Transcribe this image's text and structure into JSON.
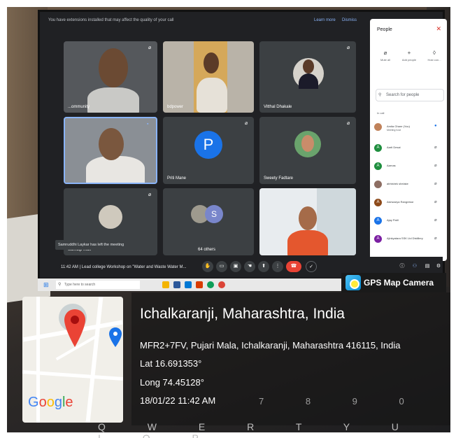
{
  "banner": {
    "text": "You have extensions installed that may affect the quality of your call",
    "learn_more": "Learn more",
    "dismiss": "Dismiss"
  },
  "tiles": [
    {
      "name": "...ommunity"
    },
    {
      "name": "bdpower"
    },
    {
      "name": "Vitthal Dhakale"
    },
    {
      "name": "",
      "initial": ""
    },
    {
      "name": "Priti Mane",
      "initial": "P"
    },
    {
      "name": "Sweety Fadtare"
    },
    {
      "name": "Samdip Mali"
    },
    {
      "name": "64 others",
      "initial": "S"
    },
    {
      "name": ""
    }
  ],
  "toast": "Samruddhi Laykar has left the meeting",
  "callbar": {
    "time_title": "11:42 AM  |  Lead college Workshop on \"Water and Waste Water M..."
  },
  "people": {
    "title": "People",
    "actions": [
      "Mute all",
      "Add people",
      "Host con..."
    ],
    "search_placeholder": "Search for people",
    "in_call_label": "In call",
    "rows": [
      {
        "name": "Amita Ghare (You)",
        "sub": "Meeting host",
        "initial": "",
        "color": "#c0825a"
      },
      {
        "name": "Aarti Desai",
        "sub": "",
        "initial": "A",
        "color": "#1e8e3e"
      },
      {
        "name": "Aarnas",
        "sub": "",
        "initial": "A",
        "color": "#1e8e3e"
      },
      {
        "name": "abhishek shelake",
        "sub": "",
        "initial": "",
        "color": "#8d6e63"
      },
      {
        "name": "Aishwarya Rangrekar",
        "sub": "",
        "initial": "A",
        "color": "#8d4a1a"
      },
      {
        "name": "Ajay Patil",
        "sub": "",
        "initial": "A",
        "color": "#1a73e8"
      },
      {
        "name": "Ajinkyatara SSK Ltd Distillery",
        "sub": "",
        "initial": "A",
        "color": "#7b1fa2"
      }
    ]
  },
  "taskbar": {
    "search_placeholder": "Type here to search"
  },
  "gps": {
    "brand": "GPS Map Camera",
    "city": "Ichalkaranji, Maharashtra, India",
    "address": "MFR2+7FV, Pujari Mala, Ichalkaranji, Maharashtra 416115, India",
    "lat": "Lat 16.691353°",
    "long": "Long 74.45128°",
    "datetime": "18/01/22 11:42 AM",
    "map_logo": "Google"
  },
  "keyboard": {
    "row_numbers": "7 8 9 0",
    "row_letters": "Q W E R T Y U I O P"
  },
  "colors": {
    "meet_bg": "#202124",
    "tile_bg": "#3c4043",
    "end_call": "#ea4335",
    "accent_blue": "#1a73e8"
  }
}
